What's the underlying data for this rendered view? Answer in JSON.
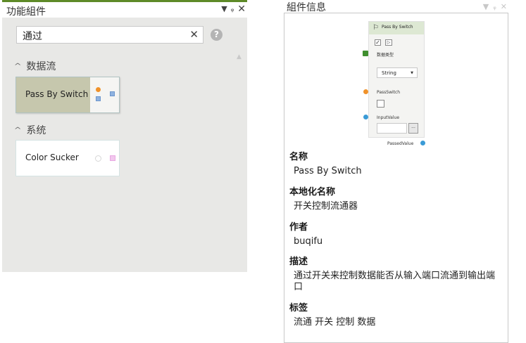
{
  "left_panel": {
    "title": "功能組件",
    "header_icons": [
      "chevron-down-icon",
      "pin-icon",
      "close-icon"
    ],
    "search": {
      "value": "通过",
      "clear_glyph": "✕",
      "help_glyph": "?"
    },
    "groups": [
      {
        "name": "数据流",
        "items": [
          {
            "label": "Pass By Switch",
            "selected": true
          }
        ]
      },
      {
        "name": "系统",
        "items": [
          {
            "label": "Color Sucker",
            "selected": false
          }
        ]
      }
    ]
  },
  "right_panel": {
    "title": "組件信息",
    "header_icons": [
      "chevron-down-icon",
      "pin-icon",
      "close-icon"
    ],
    "node_preview": {
      "title": "Pass By Switch",
      "data_type_label": "数据类型",
      "data_type_value": "String",
      "pass_switch_label": "PassSwitch",
      "input_value_label": "InputValue",
      "input_button": "...",
      "output_label": "PassedValue",
      "colors": {
        "header": "#dde8d3",
        "data_type_port": "#3f8f2f",
        "pass_switch_port": "#f0922a",
        "value_port": "#3a9bd6"
      }
    },
    "sections": [
      {
        "heading": "名称",
        "value": "Pass By Switch"
      },
      {
        "heading": "本地化名称",
        "value": "开关控制流通器"
      },
      {
        "heading": "作者",
        "value": "buqifu"
      },
      {
        "heading": "描述",
        "value": "通过开关来控制数据能否从输入端口流通到输出端口"
      },
      {
        "heading": "标签",
        "value": "流通 开关 控制 数据"
      }
    ]
  }
}
